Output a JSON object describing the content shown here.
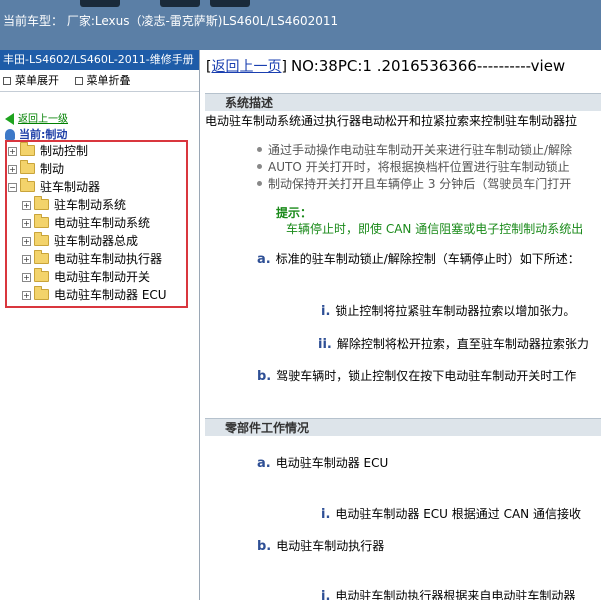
{
  "header": {
    "car_text": "当前车型： 厂家:Lexus（凌志-雷克萨斯)LS460L/LS4602011"
  },
  "left": {
    "title": "丰田-LS4602/LS460L-2011-维修手册",
    "expand_label": "菜单展开",
    "collapse_label": "菜单折叠",
    "back_label": "返回上一级",
    "current_label": "当前:制动",
    "tree": [
      {
        "label": "制动控制"
      },
      {
        "label": "制动"
      },
      {
        "label": "驻车制动器"
      },
      {
        "label": "驻车制动系统"
      },
      {
        "label": "电动驻车制动系统"
      },
      {
        "label": "驻车制动器总成"
      },
      {
        "label": "电动驻车制动执行器"
      },
      {
        "label": "电动驻车制动开关"
      },
      {
        "label": "电动驻车制动器 ECU"
      }
    ]
  },
  "right": {
    "back_link": "返回上一页",
    "doc_no": "NO:38PC:1 .2016536366----------view",
    "section1": "系统描述",
    "intro": "电动驻车制动系统通过执行器电动松开和拉紧拉索来控制驻车制动器拉",
    "bullets": [
      "通过手动操作电动驻车制动开关来进行驻车制动锁止/解除",
      "AUTO 开关打开时，将根据换档杆位置进行驻车制动锁止",
      "制动保持开关打开且车辆停止 3 分钟后（驾驶员车门打开"
    ],
    "tip_label": "提示：",
    "tip_text": "车辆停止时，即使 CAN 通信阻塞或电子控制制动系统出",
    "a1_mark": "a.",
    "a1_text": "标准的驻车制动锁止/解除控制（车辆停止时）如下所述：",
    "i1_mark": "i.",
    "i1_text": "锁止控制将拉紧驻车制动器拉索以增加张力。",
    "ii1_mark": "ii.",
    "ii1_text": "解除控制将松开拉索，直至驻车制动器拉索张力",
    "b1_mark": "b.",
    "b1_text": "驾驶车辆时，锁止控制仅在按下电动驻车制动开关时工作",
    "section2": "零部件工作情况",
    "a2_mark": "a.",
    "a2_text": "电动驻车制动器 ECU",
    "i2_mark": "i.",
    "i2_text": "电动驻车制动器 ECU 根据通过 CAN 通信接收",
    "b2_mark": "b.",
    "b2_text": "电动驻车制动执行器",
    "i3_mark": "i.",
    "i3_text": "电动驻车制动执行器根据来自电动驻车制动器"
  }
}
